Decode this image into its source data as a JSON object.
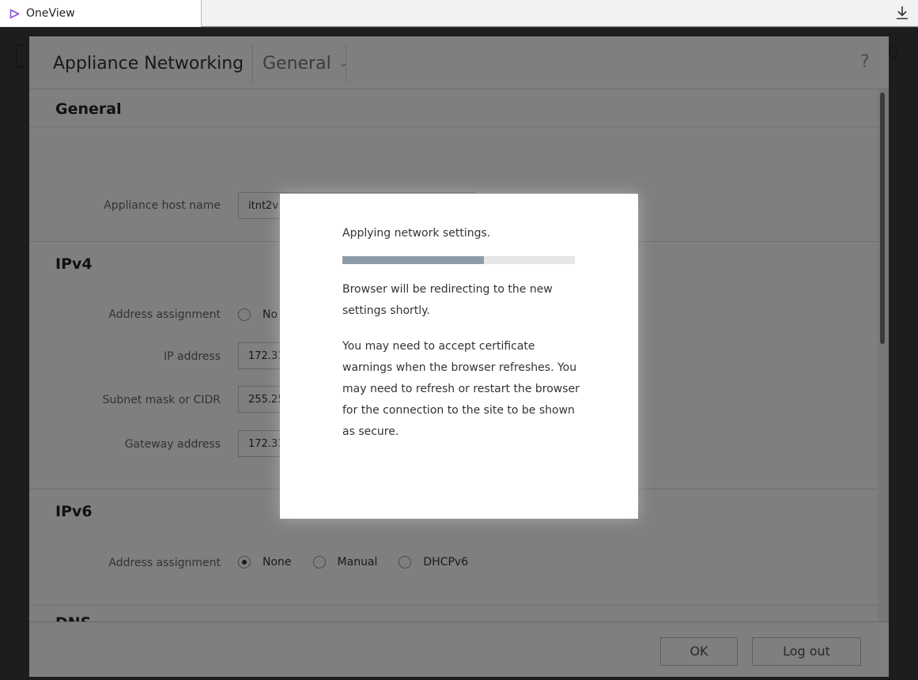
{
  "browser": {
    "tab_title": "OneView",
    "tab_icon": "oneview-logo-icon",
    "download_icon": "download-icon"
  },
  "dialog": {
    "title": "Appliance Networking",
    "section_selector": "General",
    "help": "?"
  },
  "sections": {
    "general": {
      "title": "General",
      "host_name_label": "Appliance host name",
      "host_name_value": "itnt2v"
    },
    "ipv4": {
      "title": "IPv4",
      "address_assignment_label": "Address assignment",
      "address_assignment_visible": "No",
      "ip_label": "IP address",
      "ip_value": "172.31",
      "subnet_label": "Subnet mask or CIDR",
      "subnet_value": "255.25",
      "gateway_label": "Gateway address",
      "gateway_value": "172.31"
    },
    "ipv6": {
      "title": "IPv6",
      "address_assignment_label": "Address assignment",
      "options": [
        "None",
        "Manual",
        "DHCPv6"
      ],
      "selected": "None"
    },
    "next_partial_title": "DNS"
  },
  "footer": {
    "ok_label": "OK",
    "logout_label": "Log out"
  },
  "modal": {
    "title": "Applying network settings.",
    "progress": 0.61,
    "message1": "Browser will be redirecting to the new settings shortly.",
    "message2": "You may need to accept certificate warnings when the browser refreshes. You may need to refresh or restart the browser for the connection to the site to be shown as secure."
  },
  "colors": {
    "progress_fill": "#8e9ca8",
    "progress_track": "#e6e6e6",
    "tab_icon": "#8a4fd8"
  }
}
